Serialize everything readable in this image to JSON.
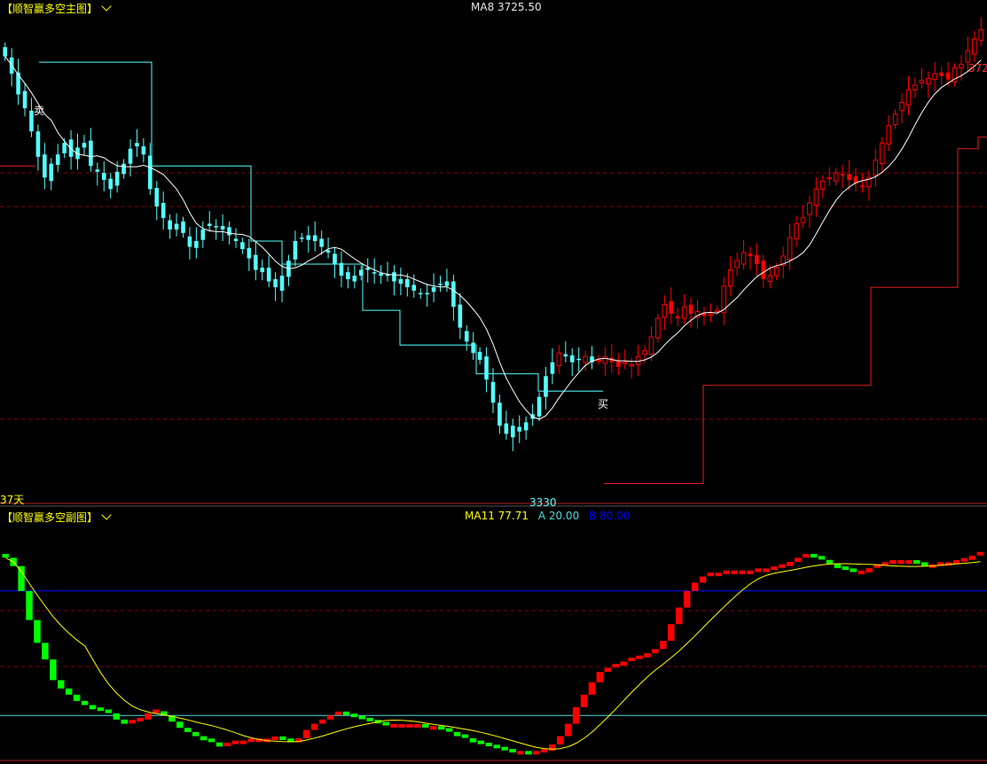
{
  "main_panel": {
    "title": "【顺智赢多空主图】",
    "ma_label": "MA8 3725.50",
    "high_label": "372",
    "low_label": "3330",
    "days_label": "37天",
    "sell_marker": "卖",
    "buy_marker": "买"
  },
  "sub_panel": {
    "title": "【顺智赢多空副图】",
    "ma_label": "MA11 77.71",
    "a_label": "A 20.00",
    "b_label": "B 80.00"
  },
  "colors": {
    "background": "#000000",
    "title": "#ffff00",
    "bear_candle": "#54ffff",
    "bull_candle": "#ff0000",
    "ma_line": "#ffffff",
    "sub_ma_line": "#ffff00",
    "osc_up": "#ff0000",
    "osc_down": "#00ff00",
    "level_b": "#0000ff",
    "level_a": "#4dd9d9",
    "grid_dashed": "#8b0000"
  },
  "chart_data": [
    {
      "type": "candlestick",
      "panel": "main",
      "price_range": [
        3320,
        3740
      ],
      "closes": [
        3705,
        3690,
        3672,
        3660,
        3640,
        3618,
        3600,
        3612,
        3620,
        3630,
        3618,
        3626,
        3630,
        3610,
        3605,
        3598,
        3590,
        3605,
        3612,
        3625,
        3630,
        3620,
        3590,
        3575,
        3565,
        3555,
        3560,
        3552,
        3540,
        3545,
        3555,
        3560,
        3558,
        3555,
        3550,
        3545,
        3538,
        3530,
        3520,
        3522,
        3510,
        3505,
        3515,
        3528,
        3545,
        3548,
        3550,
        3545,
        3540,
        3535,
        3525,
        3515,
        3512,
        3515,
        3520,
        3520,
        3518,
        3515,
        3515,
        3510,
        3512,
        3505,
        3502,
        3500,
        3500,
        3505,
        3508,
        3510,
        3488,
        3470,
        3458,
        3448,
        3442,
        3425,
        3405,
        3385,
        3378,
        3385,
        3380,
        3388,
        3395,
        3410,
        3428,
        3440,
        3448,
        3445,
        3440,
        3442,
        3445,
        3440,
        3442,
        3445,
        3440,
        3436,
        3440,
        3438,
        3445,
        3450,
        3462,
        3478,
        3490,
        3482,
        3478,
        3488,
        3482,
        3484,
        3480,
        3482,
        3485,
        3506,
        3520,
        3528,
        3535,
        3532,
        3525,
        3512,
        3515,
        3522,
        3532,
        3548,
        3560,
        3565,
        3578,
        3590,
        3597,
        3600,
        3604,
        3602,
        3598,
        3595,
        3592,
        3600,
        3615,
        3630,
        3645,
        3655,
        3665,
        3676,
        3680,
        3684,
        3686,
        3690,
        3688,
        3685,
        3695,
        3698,
        3710,
        3720,
        3728
      ],
      "ma8_last": 3725.5,
      "support_resistance_steps": [
        3700,
        3610,
        3545,
        3525,
        3485,
        3455,
        3430,
        3415
      ],
      "high": 3725,
      "low": 3330
    },
    {
      "type": "oscillator",
      "panel": "sub",
      "y_range": [
        0,
        100
      ],
      "levels": {
        "A": 20.0,
        "B": 80.0
      },
      "ma11_last": 77.71,
      "values": [
        96,
        92,
        80,
        66,
        55,
        47,
        37,
        33,
        30,
        27,
        25,
        23,
        22,
        21,
        18,
        16,
        17,
        18,
        21,
        22,
        20,
        17,
        14,
        12,
        10,
        8,
        7,
        5,
        6,
        7,
        7,
        8,
        8,
        8,
        9,
        8,
        7,
        9,
        13,
        16,
        18,
        20,
        21,
        20,
        19,
        18,
        17,
        16,
        15,
        15,
        15,
        15,
        15,
        14,
        14,
        13,
        12,
        10,
        9,
        7,
        6,
        5,
        4,
        3,
        2,
        2,
        1,
        2,
        3,
        6,
        10,
        16,
        24,
        30,
        36,
        41,
        43,
        44,
        46,
        47,
        48,
        50,
        52,
        56,
        64,
        72,
        80,
        84,
        87,
        88,
        88,
        89,
        89,
        89,
        89,
        90,
        90,
        91,
        92,
        94,
        96,
        97,
        96,
        95,
        93,
        91,
        90,
        89,
        89,
        91,
        92,
        93,
        94,
        94,
        94,
        93,
        92,
        92,
        93,
        93,
        94,
        95,
        97,
        98
      ]
    }
  ]
}
